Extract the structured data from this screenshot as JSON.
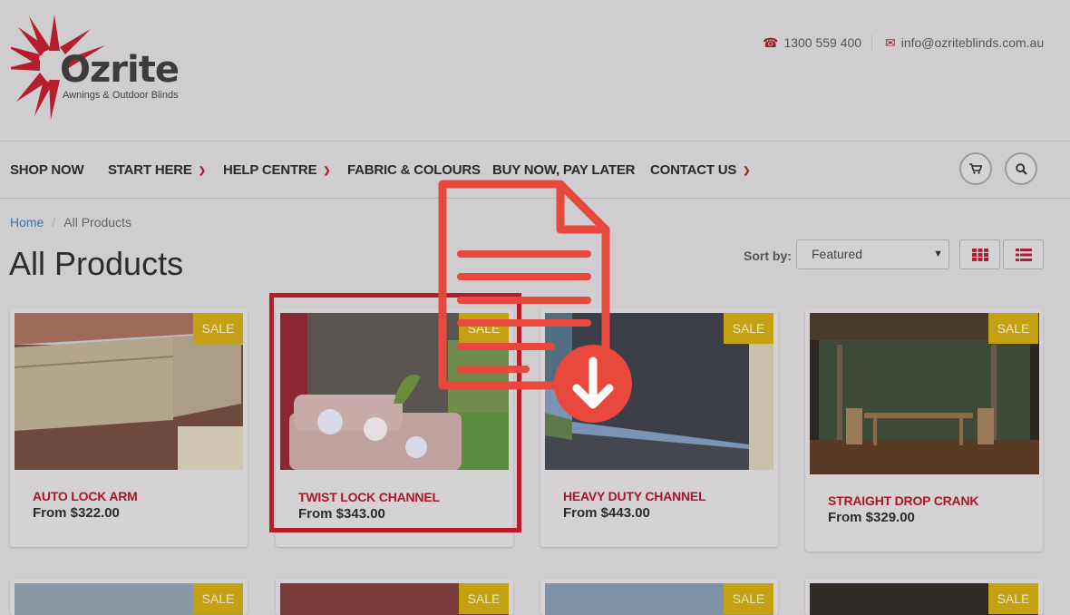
{
  "header": {
    "logo_text": "Ozrite",
    "logo_tagline": "Awnings & Outdoor Blinds",
    "phone": "1300 559 400",
    "email": "info@ozriteblinds.com.au",
    "icons": [
      "phone-icon",
      "envelope-icon"
    ]
  },
  "nav": {
    "items": [
      {
        "label": "SHOP NOW",
        "dropdown": false
      },
      {
        "label": "START HERE",
        "dropdown": true
      },
      {
        "label": "HELP CENTRE",
        "dropdown": true
      },
      {
        "label": "FABRIC & COLOURS",
        "dropdown": false
      },
      {
        "label": "BUY NOW, PAY LATER",
        "dropdown": false
      },
      {
        "label": "CONTACT US",
        "dropdown": true
      }
    ],
    "cart_icon": "cart-icon",
    "search_icon": "search-icon"
  },
  "breadcrumb": {
    "home": "Home",
    "current": "All Products"
  },
  "page_title": "All Products",
  "sort": {
    "label": "Sort by:",
    "selected": "Featured",
    "view_icons": [
      "grid-view-icon",
      "list-view-icon"
    ]
  },
  "products": [
    {
      "name": "AUTO LOCK ARM",
      "price": "From $322.00",
      "badge": "SALE"
    },
    {
      "name": "TWIST LOCK CHANNEL",
      "price": "From $343.00",
      "badge": "SALE"
    },
    {
      "name": "HEAVY DUTY CHANNEL",
      "price": "From $443.00",
      "badge": "SALE"
    },
    {
      "name": "STRAIGHT DROP CRANK",
      "price": "From $329.00",
      "badge": "SALE"
    }
  ],
  "next_row_badges": [
    "SALE",
    "SALE",
    "SALE",
    "SALE"
  ],
  "colors": {
    "accent": "#a5192a",
    "sale_badge": "#c4a112",
    "link": "#3c78a6",
    "overlay_red": "#e8493c"
  }
}
